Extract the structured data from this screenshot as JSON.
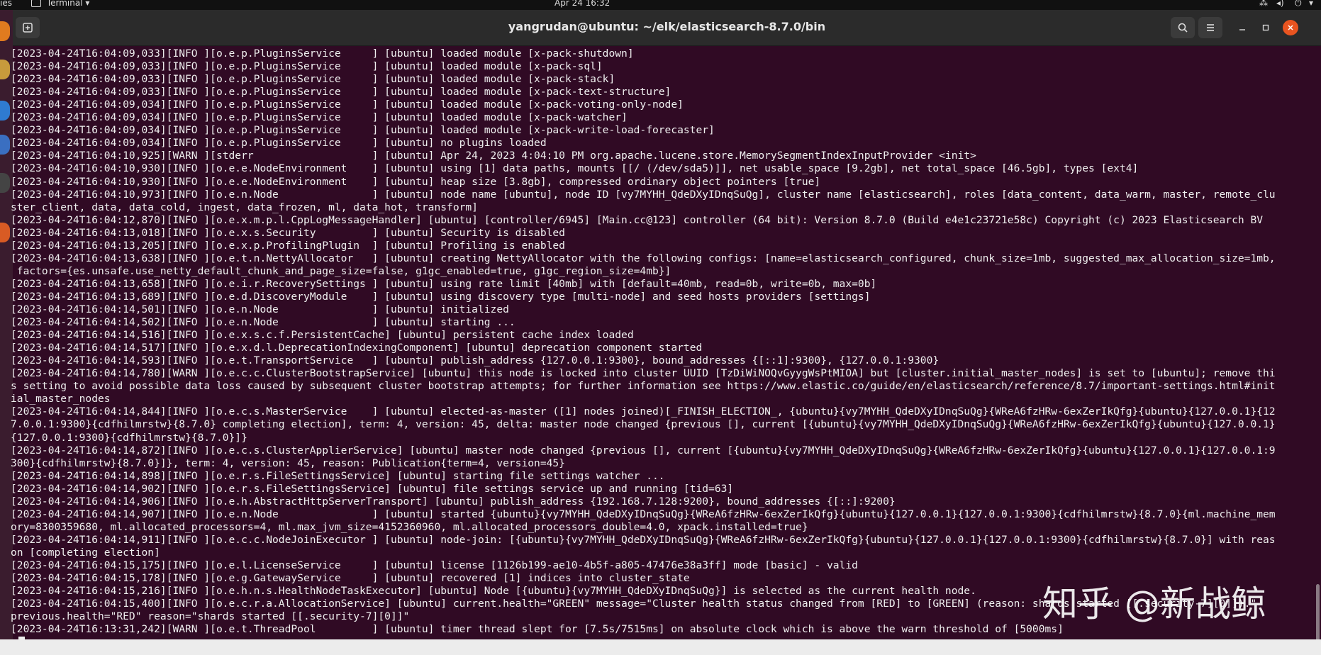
{
  "topbar": {
    "activities": "ies",
    "app_menu": "Terminal",
    "clock": "Apr 24  16:32"
  },
  "window": {
    "title": "yangrudan@ubuntu: ~/elk/elasticsearch-8.7.0/bin",
    "icons": {
      "new_tab": "new-tab-icon",
      "search": "search-icon",
      "menu": "hamburger-menu-icon",
      "minimize": "minimize-icon",
      "maximize": "maximize-icon",
      "close": "close-icon"
    }
  },
  "colors": {
    "terminal_bg": "#300a24",
    "titlebar_bg": "#2b2b2b",
    "close_button": "#e95420",
    "text": "#efefef"
  },
  "terminal": {
    "lines": [
      "[2023-04-24T16:04:09,033][INFO ][o.e.p.PluginsService     ] [ubuntu] loaded module [x-pack-shutdown]",
      "[2023-04-24T16:04:09,033][INFO ][o.e.p.PluginsService     ] [ubuntu] loaded module [x-pack-sql]",
      "[2023-04-24T16:04:09,033][INFO ][o.e.p.PluginsService     ] [ubuntu] loaded module [x-pack-stack]",
      "[2023-04-24T16:04:09,033][INFO ][o.e.p.PluginsService     ] [ubuntu] loaded module [x-pack-text-structure]",
      "[2023-04-24T16:04:09,034][INFO ][o.e.p.PluginsService     ] [ubuntu] loaded module [x-pack-voting-only-node]",
      "[2023-04-24T16:04:09,034][INFO ][o.e.p.PluginsService     ] [ubuntu] loaded module [x-pack-watcher]",
      "[2023-04-24T16:04:09,034][INFO ][o.e.p.PluginsService     ] [ubuntu] loaded module [x-pack-write-load-forecaster]",
      "[2023-04-24T16:04:09,034][INFO ][o.e.p.PluginsService     ] [ubuntu] no plugins loaded",
      "[2023-04-24T16:04:10,925][WARN ][stderr                   ] [ubuntu] Apr 24, 2023 4:04:10 PM org.apache.lucene.store.MemorySegmentIndexInputProvider <init>",
      "[2023-04-24T16:04:10,930][INFO ][o.e.e.NodeEnvironment    ] [ubuntu] using [1] data paths, mounts [[/ (/dev/sda5)]], net usable_space [9.2gb], net total_space [46.5gb], types [ext4]",
      "[2023-04-24T16:04:10,930][INFO ][o.e.e.NodeEnvironment    ] [ubuntu] heap size [3.8gb], compressed ordinary object pointers [true]",
      "[2023-04-24T16:04:10,973][INFO ][o.e.n.Node               ] [ubuntu] node name [ubuntu], node ID [vy7MYHH_QdeDXyIDnqSuQg], cluster name [elasticsearch], roles [data_content, data_warm, master, remote_clu",
      "ster_client, data, data_cold, ingest, data_frozen, ml, data_hot, transform]",
      "[2023-04-24T16:04:12,870][INFO ][o.e.x.m.p.l.CppLogMessageHandler] [ubuntu] [controller/6945] [Main.cc@123] controller (64 bit): Version 8.7.0 (Build e4e1c23721e58c) Copyright (c) 2023 Elasticsearch BV",
      "[2023-04-24T16:04:13,018][INFO ][o.e.x.s.Security         ] [ubuntu] Security is disabled",
      "[2023-04-24T16:04:13,205][INFO ][o.e.x.p.ProfilingPlugin  ] [ubuntu] Profiling is enabled",
      "[2023-04-24T16:04:13,638][INFO ][o.e.t.n.NettyAllocator   ] [ubuntu] creating NettyAllocator with the following configs: [name=elasticsearch_configured, chunk_size=1mb, suggested_max_allocation_size=1mb,",
      " factors={es.unsafe.use_netty_default_chunk_and_page_size=false, g1gc_enabled=true, g1gc_region_size=4mb}]",
      "[2023-04-24T16:04:13,658][INFO ][o.e.i.r.RecoverySettings ] [ubuntu] using rate limit [40mb] with [default=40mb, read=0b, write=0b, max=0b]",
      "[2023-04-24T16:04:13,689][INFO ][o.e.d.DiscoveryModule    ] [ubuntu] using discovery type [multi-node] and seed hosts providers [settings]",
      "[2023-04-24T16:04:14,501][INFO ][o.e.n.Node               ] [ubuntu] initialized",
      "[2023-04-24T16:04:14,502][INFO ][o.e.n.Node               ] [ubuntu] starting ...",
      "[2023-04-24T16:04:14,516][INFO ][o.e.x.s.c.f.PersistentCache] [ubuntu] persistent cache index loaded",
      "[2023-04-24T16:04:14,517][INFO ][o.e.x.d.l.DeprecationIndexingComponent] [ubuntu] deprecation component started",
      "[2023-04-24T16:04:14,593][INFO ][o.e.t.TransportService   ] [ubuntu] publish_address {127.0.0.1:9300}, bound_addresses {[::1]:9300}, {127.0.0.1:9300}",
      "[2023-04-24T16:04:14,780][WARN ][o.e.c.c.ClusterBootstrapService] [ubuntu] this node is locked into cluster UUID [TzDiWiNOQvGyygWsPtMIOA] but [cluster.initial_master_nodes] is set to [ubuntu]; remove thi",
      "s setting to avoid possible data loss caused by subsequent cluster bootstrap attempts; for further information see https://www.elastic.co/guide/en/elasticsearch/reference/8.7/important-settings.html#init",
      "ial_master_nodes",
      "[2023-04-24T16:04:14,844][INFO ][o.e.c.s.MasterService    ] [ubuntu] elected-as-master ([1] nodes joined)[_FINISH_ELECTION_, {ubuntu}{vy7MYHH_QdeDXyIDnqSuQg}{WReA6fzHRw-6exZerIkQfg}{ubuntu}{127.0.0.1}{12",
      "7.0.0.1:9300}{cdfhilmrstw}{8.7.0} completing election], term: 4, version: 45, delta: master node changed {previous [], current [{ubuntu}{vy7MYHH_QdeDXyIDnqSuQg}{WReA6fzHRw-6exZerIkQfg}{ubuntu}{127.0.0.1}",
      "{127.0.0.1:9300}{cdfhilmrstw}{8.7.0}]}",
      "[2023-04-24T16:04:14,872][INFO ][o.e.c.s.ClusterApplierService] [ubuntu] master node changed {previous [], current [{ubuntu}{vy7MYHH_QdeDXyIDnqSuQg}{WReA6fzHRw-6exZerIkQfg}{ubuntu}{127.0.0.1}{127.0.0.1:9",
      "300}{cdfhilmrstw}{8.7.0}]}, term: 4, version: 45, reason: Publication{term=4, version=45}",
      "[2023-04-24T16:04:14,898][INFO ][o.e.r.s.FileSettingsService] [ubuntu] starting file settings watcher ...",
      "[2023-04-24T16:04:14,902][INFO ][o.e.r.s.FileSettingsService] [ubuntu] file settings service up and running [tid=63]",
      "[2023-04-24T16:04:14,906][INFO ][o.e.h.AbstractHttpServerTransport] [ubuntu] publish_address {192.168.7.128:9200}, bound_addresses {[::]:9200}",
      "[2023-04-24T16:04:14,907][INFO ][o.e.n.Node               ] [ubuntu] started {ubuntu}{vy7MYHH_QdeDXyIDnqSuQg}{WReA6fzHRw-6exZerIkQfg}{ubuntu}{127.0.0.1}{127.0.0.1:9300}{cdfhilmrstw}{8.7.0}{ml.machine_mem",
      "ory=8300359680, ml.allocated_processors=4, ml.max_jvm_size=4152360960, ml.allocated_processors_double=4.0, xpack.installed=true}",
      "[2023-04-24T16:04:14,911][INFO ][o.e.c.c.NodeJoinExecutor ] [ubuntu] node-join: [{ubuntu}{vy7MYHH_QdeDXyIDnqSuQg}{WReA6fzHRw-6exZerIkQfg}{ubuntu}{127.0.0.1}{127.0.0.1:9300}{cdfhilmrstw}{8.7.0}] with reas",
      "on [completing election]",
      "[2023-04-24T16:04:15,175][INFO ][o.e.l.LicenseService     ] [ubuntu] license [1126b199-ae10-4b5f-a805-47476e38a3ff] mode [basic] - valid",
      "[2023-04-24T16:04:15,178][INFO ][o.e.g.GatewayService     ] [ubuntu] recovered [1] indices into cluster_state",
      "[2023-04-24T16:04:15,216][INFO ][o.e.h.n.s.HealthNodeTaskExecutor] [ubuntu] Node [{ubuntu}{vy7MYHH_QdeDXyIDnqSuQg}] is selected as the current health node.",
      "[2023-04-24T16:04:15,400][INFO ][o.e.c.r.a.AllocationService] [ubuntu] current.health=\"GREEN\" message=\"Cluster health status changed from [RED] to [GREEN] (reason: shards started [[.security-7][0]]).\"",
      "previous.health=\"RED\" reason=\"shards started [[.security-7][0]]\"",
      "[2023-04-24T16:13:31,242][WARN ][o.e.t.ThreadPool         ] [ubuntu] timer thread slept for [7.5s/7515ms] on absolute clock which is above the warn threshold of [5000ms]",
      "s"
    ]
  },
  "watermark": "知乎 @新战鲸"
}
